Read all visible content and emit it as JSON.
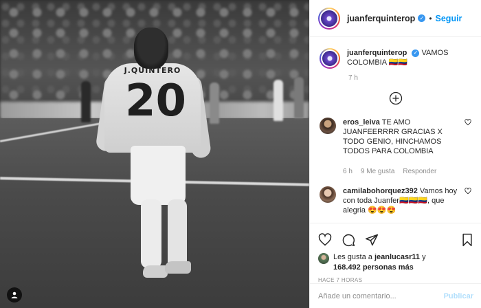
{
  "post": {
    "author": "juanferquinterop",
    "follow_label": "Seguir",
    "separator": "•",
    "photo": {
      "shirt_name": "J.QUINTERO",
      "shirt_number": "20"
    }
  },
  "caption": {
    "username": "juanferquinterop",
    "text": "VAMOS COLOMBIA 🇨🇴🇨🇴",
    "time": "7 h"
  },
  "comments": [
    {
      "username": "eros_leiva",
      "text": "TE AMO JUANFEERRRR GRACIAS X TODO GENIO, HINCHAMOS TODOS PARA COLOMBIA",
      "time": "6 h",
      "likes": "9 Me gusta",
      "reply": "Responder"
    },
    {
      "username": "camilabohorquez392",
      "text": "Vamos hoy con toda Juanfer🇨🇴🇨🇴🇨🇴, que alegria 😍😍😍"
    }
  ],
  "likes": {
    "prefix": "Les gusta a",
    "user": "jeanlucasr11",
    "joiner": "y",
    "count": "168.492 personas más"
  },
  "time_ago": "HACE 7 HORAS",
  "add_comment": {
    "placeholder": "Añade un comentario...",
    "publish": "Publicar"
  },
  "icons": [
    "heart-icon",
    "comment-icon",
    "share-icon",
    "bookmark-icon",
    "plus-circle-icon",
    "verified-icon",
    "user-tag-icon"
  ],
  "colors": {
    "accent": "#0095f6",
    "verified": "#3897f0",
    "publish_disabled": "#b2dffc",
    "muted": "#8e8e8e"
  }
}
